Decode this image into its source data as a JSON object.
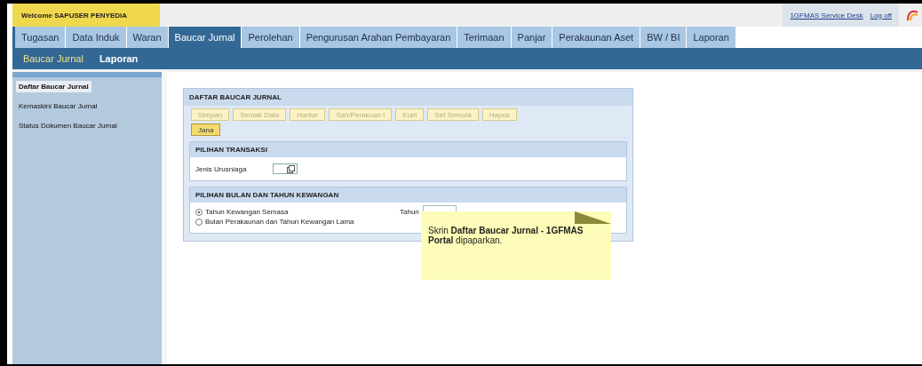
{
  "header": {
    "welcome": "Welcome SAPUSER PENYEDIA",
    "links": [
      {
        "label": "1GFMAS Service Desk"
      },
      {
        "label": "Log off"
      }
    ]
  },
  "tabs": [
    {
      "label": "Tugasan",
      "selected": false
    },
    {
      "label": "Data Induk",
      "selected": false
    },
    {
      "label": "Waran",
      "selected": false
    },
    {
      "label": "Baucar Jurnal",
      "selected": true
    },
    {
      "label": "Perolehan",
      "selected": false
    },
    {
      "label": "Pengurusan Arahan Pembayaran",
      "selected": false
    },
    {
      "label": "Terimaan",
      "selected": false
    },
    {
      "label": "Panjar",
      "selected": false
    },
    {
      "label": "Perakaunan Aset",
      "selected": false
    },
    {
      "label": "BW / BI",
      "selected": false
    },
    {
      "label": "Laporan",
      "selected": false
    }
  ],
  "subtabs": [
    {
      "label": "Baucar Jurnal",
      "selected": true
    },
    {
      "label": "Laporan",
      "selected": false
    }
  ],
  "sidebar": {
    "items": [
      {
        "label": "Daftar Baucar Jurnal",
        "selected": true
      },
      {
        "label": "Kemaskini Baucar Jurnal",
        "selected": false
      },
      {
        "label": "Status Dokumen Baucar Jurnal",
        "selected": false
      }
    ]
  },
  "panel": {
    "title": "DAFTAR BAUCAR JURNAL",
    "buttons": [
      {
        "label": "Simpan",
        "disabled": true
      },
      {
        "label": "Semak Data",
        "disabled": true
      },
      {
        "label": "Hantar",
        "disabled": true
      },
      {
        "label": "Sah/Perakuan I",
        "disabled": true
      },
      {
        "label": "Kuiri",
        "disabled": true
      },
      {
        "label": "Set Semula",
        "disabled": true
      },
      {
        "label": "Hapus",
        "disabled": true
      },
      {
        "label": "Jana",
        "disabled": false
      }
    ],
    "transaksi": {
      "title": "PILIHAN TRANSAKSI",
      "field_label": "Jenis Urusniaga"
    },
    "kewangan": {
      "title": "PILIHAN BULAN DAN TAHUN KEWANGAN",
      "options": [
        {
          "label": "Tahun Kewangan Semasa",
          "selected": true
        },
        {
          "label": "Bulan Perakaunan dan Tahun Kewangan Lama",
          "selected": false
        }
      ],
      "year_label": "Tahun"
    }
  },
  "tooltip": {
    "text": "Skrin **Daftar Baucar Jurnal - 1GFMAS Portal** dipaparkan."
  }
}
